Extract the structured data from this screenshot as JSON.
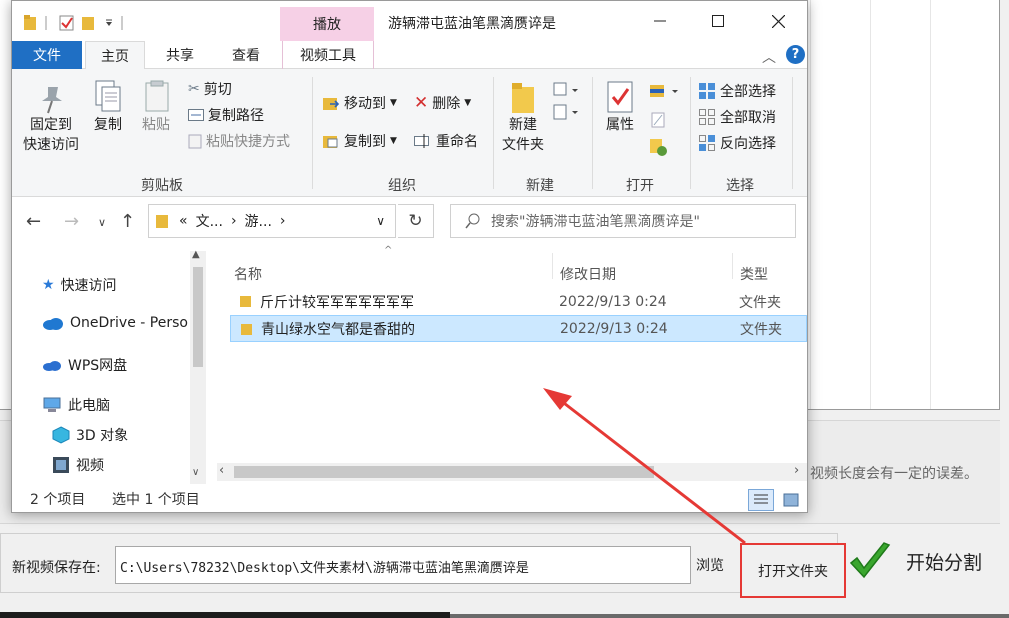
{
  "background_app": {
    "note_text": "视频长度会有一定的误差。",
    "save_label": "新视频保存在:",
    "save_path": "C:\\Users\\78232\\Desktop\\文件夹素材\\游辆滞屯蓝油笔黑滴赝谇是",
    "browse_label": "浏览",
    "open_folder_label": "打开文件夹",
    "start_split_label": "开始分割",
    "accent_colors": {
      "highlight_box": "#e53935",
      "check": "#3aa62e"
    }
  },
  "explorer": {
    "title": "游辆滞屯蓝油笔黑滴赝谇是",
    "contextual_tab": "播放",
    "tabs": {
      "file": "文件",
      "home": "主页",
      "share": "共享",
      "view": "查看",
      "video_tools": "视频工具"
    },
    "help": "?",
    "ribbon": {
      "clipboard": {
        "label": "剪贴板",
        "pin": "固定到\n快速访问",
        "copy": "复制",
        "paste": "粘贴",
        "cut": "剪切",
        "copy_path": "复制路径",
        "paste_shortcut": "粘贴快捷方式"
      },
      "organize": {
        "label": "组织",
        "move_to": "移动到",
        "copy_to": "复制到",
        "delete": "删除",
        "rename": "重命名"
      },
      "new": {
        "label": "新建",
        "new_folder": "新建\n文件夹"
      },
      "open": {
        "label": "打开",
        "properties": "属性"
      },
      "select": {
        "label": "选择",
        "select_all": "全部选择",
        "select_none": "全部取消",
        "invert": "反向选择"
      }
    },
    "address": {
      "crumb_sep": "«",
      "crumb_1": "文...",
      "crumb_2": "游...",
      "search_placeholder": "搜索\"游辆滞屯蓝油笔黑滴赝谇是\""
    },
    "nav_pane": {
      "quick_access": "快速访问",
      "onedrive": "OneDrive - Perso",
      "wps": "WPS网盘",
      "this_pc": "此电脑",
      "objects_3d": "3D 对象",
      "videos": "视频"
    },
    "columns": {
      "name": "名称",
      "modified": "修改日期",
      "type": "类型"
    },
    "files": [
      {
        "name": "斤斤计较军军军军军军军",
        "date": "2022/9/13 0:24",
        "type": "文件夹"
      },
      {
        "name": "青山绿水空气都是香甜的",
        "date": "2022/9/13 0:24",
        "type": "文件夹"
      }
    ],
    "status": {
      "item_count": "2 个项目",
      "selected": "选中 1 个项目"
    }
  }
}
